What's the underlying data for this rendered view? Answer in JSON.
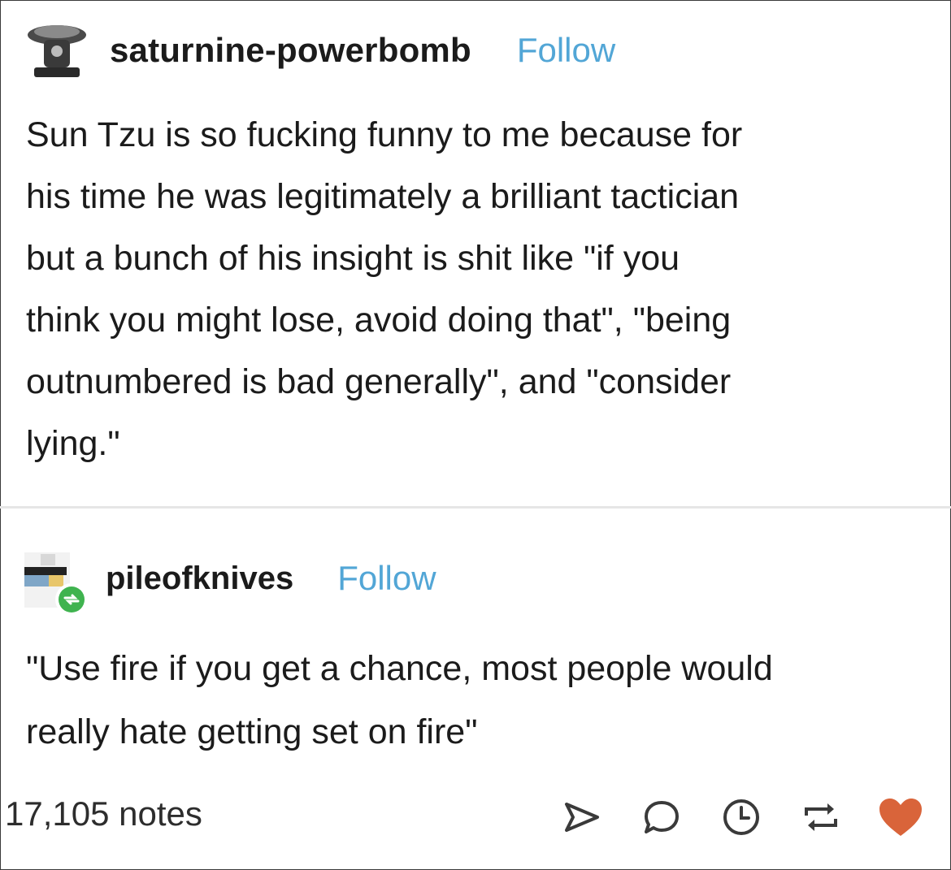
{
  "post": {
    "username": "saturnine-powerbomb",
    "follow_label": "Follow",
    "body_lines": [
      "Sun Tzu is so fucking funny to me because for",
      "his time he was legitimately a brilliant tactician",
      "but a bunch of his insight is shit like \"if you",
      "think you might lose, avoid doing that\", \"being",
      "outnumbered is bad generally\", and \"consider",
      "lying.\""
    ]
  },
  "reblog": {
    "username": "pileofknives",
    "follow_label": "Follow",
    "body_lines": [
      "\"Use fire if you get a chance, most people would",
      "really hate getting set on fire\""
    ]
  },
  "footer": {
    "notes": "17,105 notes",
    "actions": [
      "share-icon",
      "reply-icon",
      "queue-icon",
      "reblog-icon",
      "like-icon"
    ]
  },
  "colors": {
    "follow": "#52a6d6",
    "like": "#d9643a",
    "reblog_badge": "#3fb34f",
    "icon_gray": "#3a3a3a"
  }
}
